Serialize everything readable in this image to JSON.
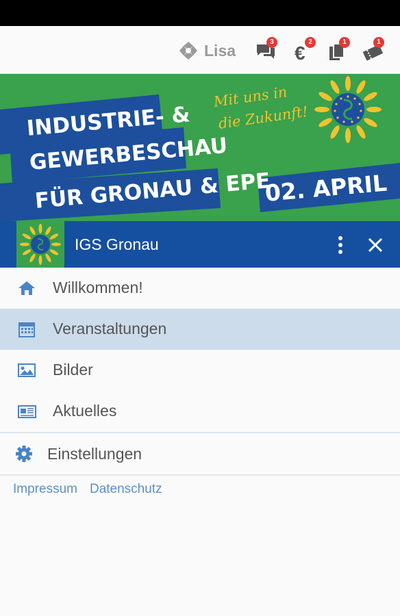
{
  "topbar": {
    "user_name": "Lisa",
    "badges": {
      "messages": "3",
      "payments": "2",
      "documents": "1",
      "tickets": "1"
    }
  },
  "banner": {
    "line1": "INDUSTRIE- &",
    "line2": "GEWERBESCHAU",
    "line3": "FÜR GRONAU & EPE",
    "date": "02. APRIL",
    "slogan1": "Mit uns in",
    "slogan2": "die Zukunft!"
  },
  "appbar": {
    "title": "IGS Gronau"
  },
  "menu": {
    "items": [
      {
        "label": "Willkommen!",
        "icon": "home-icon"
      },
      {
        "label": "Veranstaltungen",
        "icon": "calendar-icon"
      },
      {
        "label": "Bilder",
        "icon": "image-icon"
      },
      {
        "label": "Aktuelles",
        "icon": "newspaper-icon"
      }
    ],
    "settings_label": "Einstellungen"
  },
  "footer": {
    "impressum": "Impressum",
    "datenschutz": "Datenschutz"
  },
  "colors": {
    "brand_blue": "#1550a0",
    "brand_green": "#3aa14c",
    "sun_yellow": "#f1c232",
    "active_bg": "#ccdcea",
    "badge_red": "#e53935"
  }
}
